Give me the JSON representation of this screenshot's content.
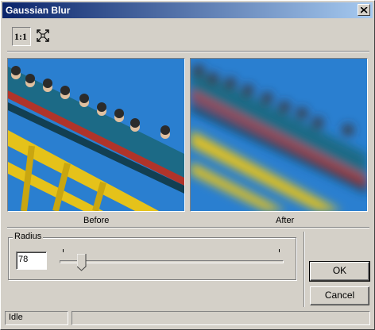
{
  "window": {
    "title": "Gaussian Blur"
  },
  "toolbar": {
    "actual_size_label": "1:1",
    "fit_icon": "fit-to-window-icon"
  },
  "preview": {
    "before_caption": "Before",
    "after_caption": "After"
  },
  "radius": {
    "label": "Radius",
    "value": "78",
    "slider_fraction": 0.08
  },
  "buttons": {
    "ok": "OK",
    "cancel": "Cancel"
  },
  "status": {
    "text": "Idle"
  },
  "colors": {
    "title_start": "#0a246a",
    "title_end": "#a6caf0",
    "sky": "#2a7fd0",
    "rail_yellow": "#e5c21a",
    "car_teal": "#1c6a86",
    "car_red": "#b0342a"
  }
}
